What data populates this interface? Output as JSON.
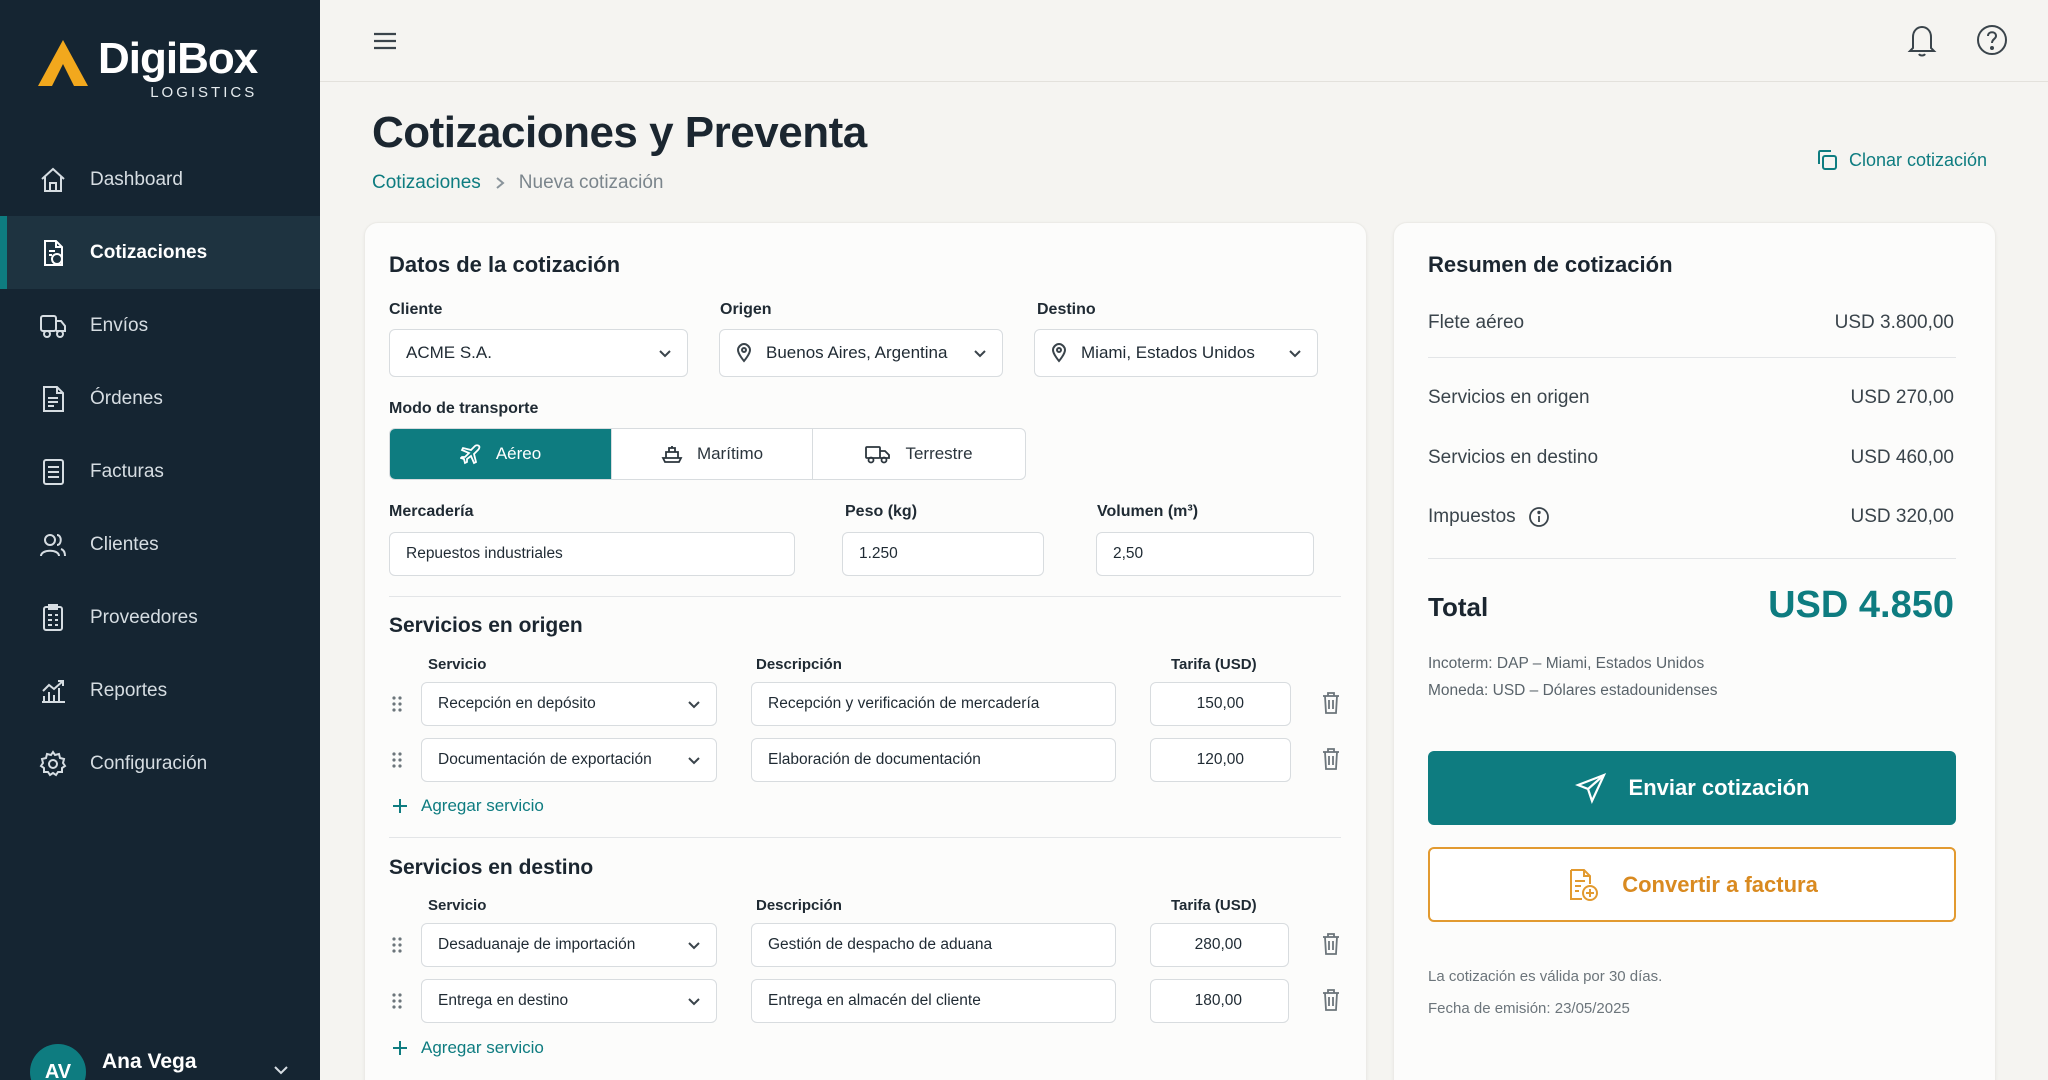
{
  "brand": {
    "name": "DigiBox",
    "sub": "LOGISTICS",
    "accent": "#0e7c80",
    "logo_color": "#f2a81d"
  },
  "sidebar": {
    "items": [
      {
        "label": "Dashboard",
        "icon": "home-icon"
      },
      {
        "label": "Cotizaciones",
        "icon": "quote-document-icon",
        "active": true
      },
      {
        "label": "Envíos",
        "icon": "truck-icon"
      },
      {
        "label": "Órdenes",
        "icon": "orders-document-icon"
      },
      {
        "label": "Facturas",
        "icon": "invoice-icon"
      },
      {
        "label": "Clientes",
        "icon": "users-icon"
      },
      {
        "label": "Proveedores",
        "icon": "supplier-document-icon"
      },
      {
        "label": "Reportes",
        "icon": "chart-icon"
      },
      {
        "label": "Configuración",
        "icon": "gear-icon"
      }
    ],
    "user": {
      "initials": "AV",
      "name": "Ana Vega"
    }
  },
  "header": {
    "title": "Cotizaciones y Preventa",
    "breadcrumb": {
      "link": "Cotizaciones",
      "current": "Nueva cotización"
    },
    "clone_label": "Clonar cotización"
  },
  "form": {
    "section_title": "Datos de la cotización",
    "cliente": {
      "label": "Cliente",
      "value": "ACME S.A."
    },
    "origen": {
      "label": "Origen",
      "value": "Buenos Aires, Argentina"
    },
    "destino": {
      "label": "Destino",
      "value": "Miami, Estados Unidos"
    },
    "modo": {
      "label": "Modo de transporte",
      "options": [
        "Aéreo",
        "Marítimo",
        "Terrestre"
      ],
      "selected": "Aéreo"
    },
    "mercaderia": {
      "label": "Mercadería",
      "value": "Repuestos industriales"
    },
    "peso": {
      "label": "Peso (kg)",
      "value": "1.250"
    },
    "volumen": {
      "label": "Volumen (m³)",
      "value": "2,50"
    }
  },
  "origen_services": {
    "title": "Servicios en origen",
    "headers": {
      "servicio": "Servicio",
      "descripcion": "Descripción",
      "tarifa": "Tarifa (USD)"
    },
    "rows": [
      {
        "servicio": "Recepción en depósito",
        "descripcion": "Recepción y verificación de mercadería",
        "tarifa": "150,00"
      },
      {
        "servicio": "Documentación de exportación",
        "descripcion": "Elaboración de documentación",
        "tarifa": "120,00"
      }
    ],
    "add_label": "Agregar servicio"
  },
  "destino_services": {
    "title": "Servicios en destino",
    "headers": {
      "servicio": "Servicio",
      "descripcion": "Descripción",
      "tarifa": "Tarifa (USD)"
    },
    "rows": [
      {
        "servicio": "Desaduanaje de importación",
        "descripcion": "Gestión de despacho de aduana",
        "tarifa": "280,00"
      },
      {
        "servicio": "Entrega en destino",
        "descripcion": "Entrega en almacén del cliente",
        "tarifa": "180,00"
      }
    ],
    "add_label": "Agregar servicio"
  },
  "summary": {
    "title": "Resumen de cotización",
    "lines": [
      {
        "label": "Flete aéreo",
        "value": "USD 3.800,00"
      },
      {
        "label": "Servicios en origen",
        "value": "USD 270,00"
      },
      {
        "label": "Servicios en destino",
        "value": "USD 460,00"
      },
      {
        "label": "Impuestos",
        "value": "USD 320,00"
      }
    ],
    "total_label": "Total",
    "total_value": "USD 4.850",
    "incoterm": "Incoterm: DAP – Miami, Estados Unidos",
    "moneda": "Moneda: USD – Dólares estadounidenses",
    "send_label": "Enviar cotización",
    "invoice_label": "Convertir a factura",
    "validity": "La cotización es válida por 30 días.",
    "issue_date": "Fecha de emisión: 23/05/2025"
  }
}
